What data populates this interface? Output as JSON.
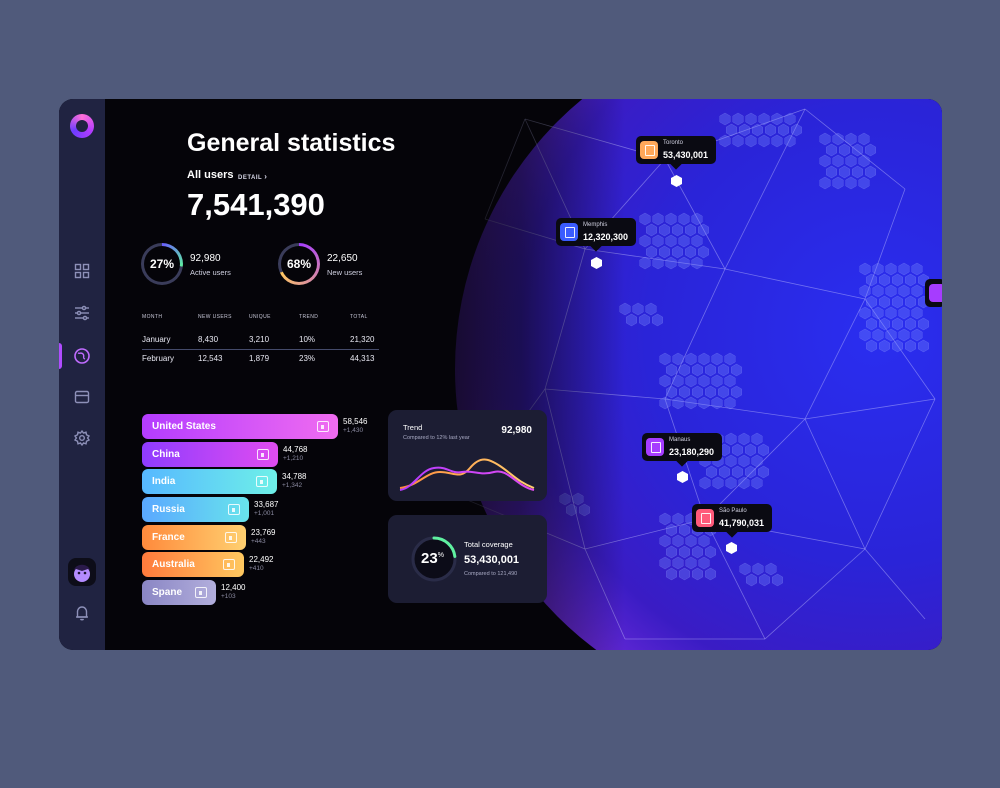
{
  "header": {
    "title": "General statistics",
    "all_users_label": "All users",
    "detail_link": "DETAIL",
    "total_users": "7,541,390"
  },
  "summary": [
    {
      "percent": "27%",
      "value": "92,980",
      "label": "Active users",
      "fraction": 0.27
    },
    {
      "percent": "68%",
      "value": "22,650",
      "label": "New users",
      "fraction": 0.68
    }
  ],
  "monthly_table": {
    "columns": [
      "MONTH",
      "NEW USERS",
      "UNIQUE",
      "TREND",
      "TOTAL"
    ],
    "rows": [
      [
        "January",
        "8,430",
        "3,210",
        "10%",
        "21,320"
      ],
      [
        "February",
        "12,543",
        "1,879",
        "23%",
        "44,313"
      ]
    ]
  },
  "countries": [
    {
      "name": "United States",
      "value": "58,546",
      "delta": "+1,430",
      "color_from": "#b43cff",
      "color_to": "#f06cf0",
      "icon": "building-icon"
    },
    {
      "name": "China",
      "value": "44,768",
      "delta": "+1,210",
      "color_from": "#8f3cff",
      "color_to": "#e04cf0",
      "icon": "temple-icon"
    },
    {
      "name": "India",
      "value": "34,788",
      "delta": "+1,342",
      "color_from": "#57b8ff",
      "color_to": "#6ef0e8",
      "icon": "monument-icon"
    },
    {
      "name": "Russia",
      "value": "33,687",
      "delta": "+1,001",
      "color_from": "#5aa8ff",
      "color_to": "#68e4ec",
      "icon": "church-icon"
    },
    {
      "name": "France",
      "value": "23,769",
      "delta": "+443",
      "color_from": "#ff8a3c",
      "color_to": "#ffd070",
      "icon": "tower-icon"
    },
    {
      "name": "Australia",
      "value": "22,492",
      "delta": "+410",
      "color_from": "#ff7a3c",
      "color_to": "#ffc860",
      "icon": "opera-icon"
    },
    {
      "name": "Spane",
      "value": "12,400",
      "delta": "+103",
      "color_from": "#8a86c4",
      "color_to": "#b2aedc",
      "icon": "bank-icon"
    }
  ],
  "trend_card": {
    "title": "Trend",
    "subtitle": "Compared to 12% last year",
    "value": "92,980"
  },
  "coverage_card": {
    "percent": "23",
    "percent_sign": "%",
    "title": "Total coverage",
    "value": "53,430,001",
    "subtitle": "Compared to 121,490",
    "fraction": 0.23
  },
  "map_pins": [
    {
      "city": "Toronto",
      "value": "53,430,001",
      "color": "#ffa85a"
    },
    {
      "city": "Memphis",
      "value": "12,320,300",
      "color": "#3a5cff"
    },
    {
      "city": "Manaus",
      "value": "23,180,290",
      "color": "#a63cff"
    },
    {
      "city": "São Paulo",
      "value": "41,790,031",
      "color": "#ff5a7a"
    }
  ],
  "nav": [
    "dashboard-icon",
    "sliders-icon",
    "globe-icon",
    "card-icon",
    "settings-icon"
  ],
  "colors": {
    "accent": "#b04cff",
    "background": "#505a7b",
    "sidebar": "#202341"
  }
}
